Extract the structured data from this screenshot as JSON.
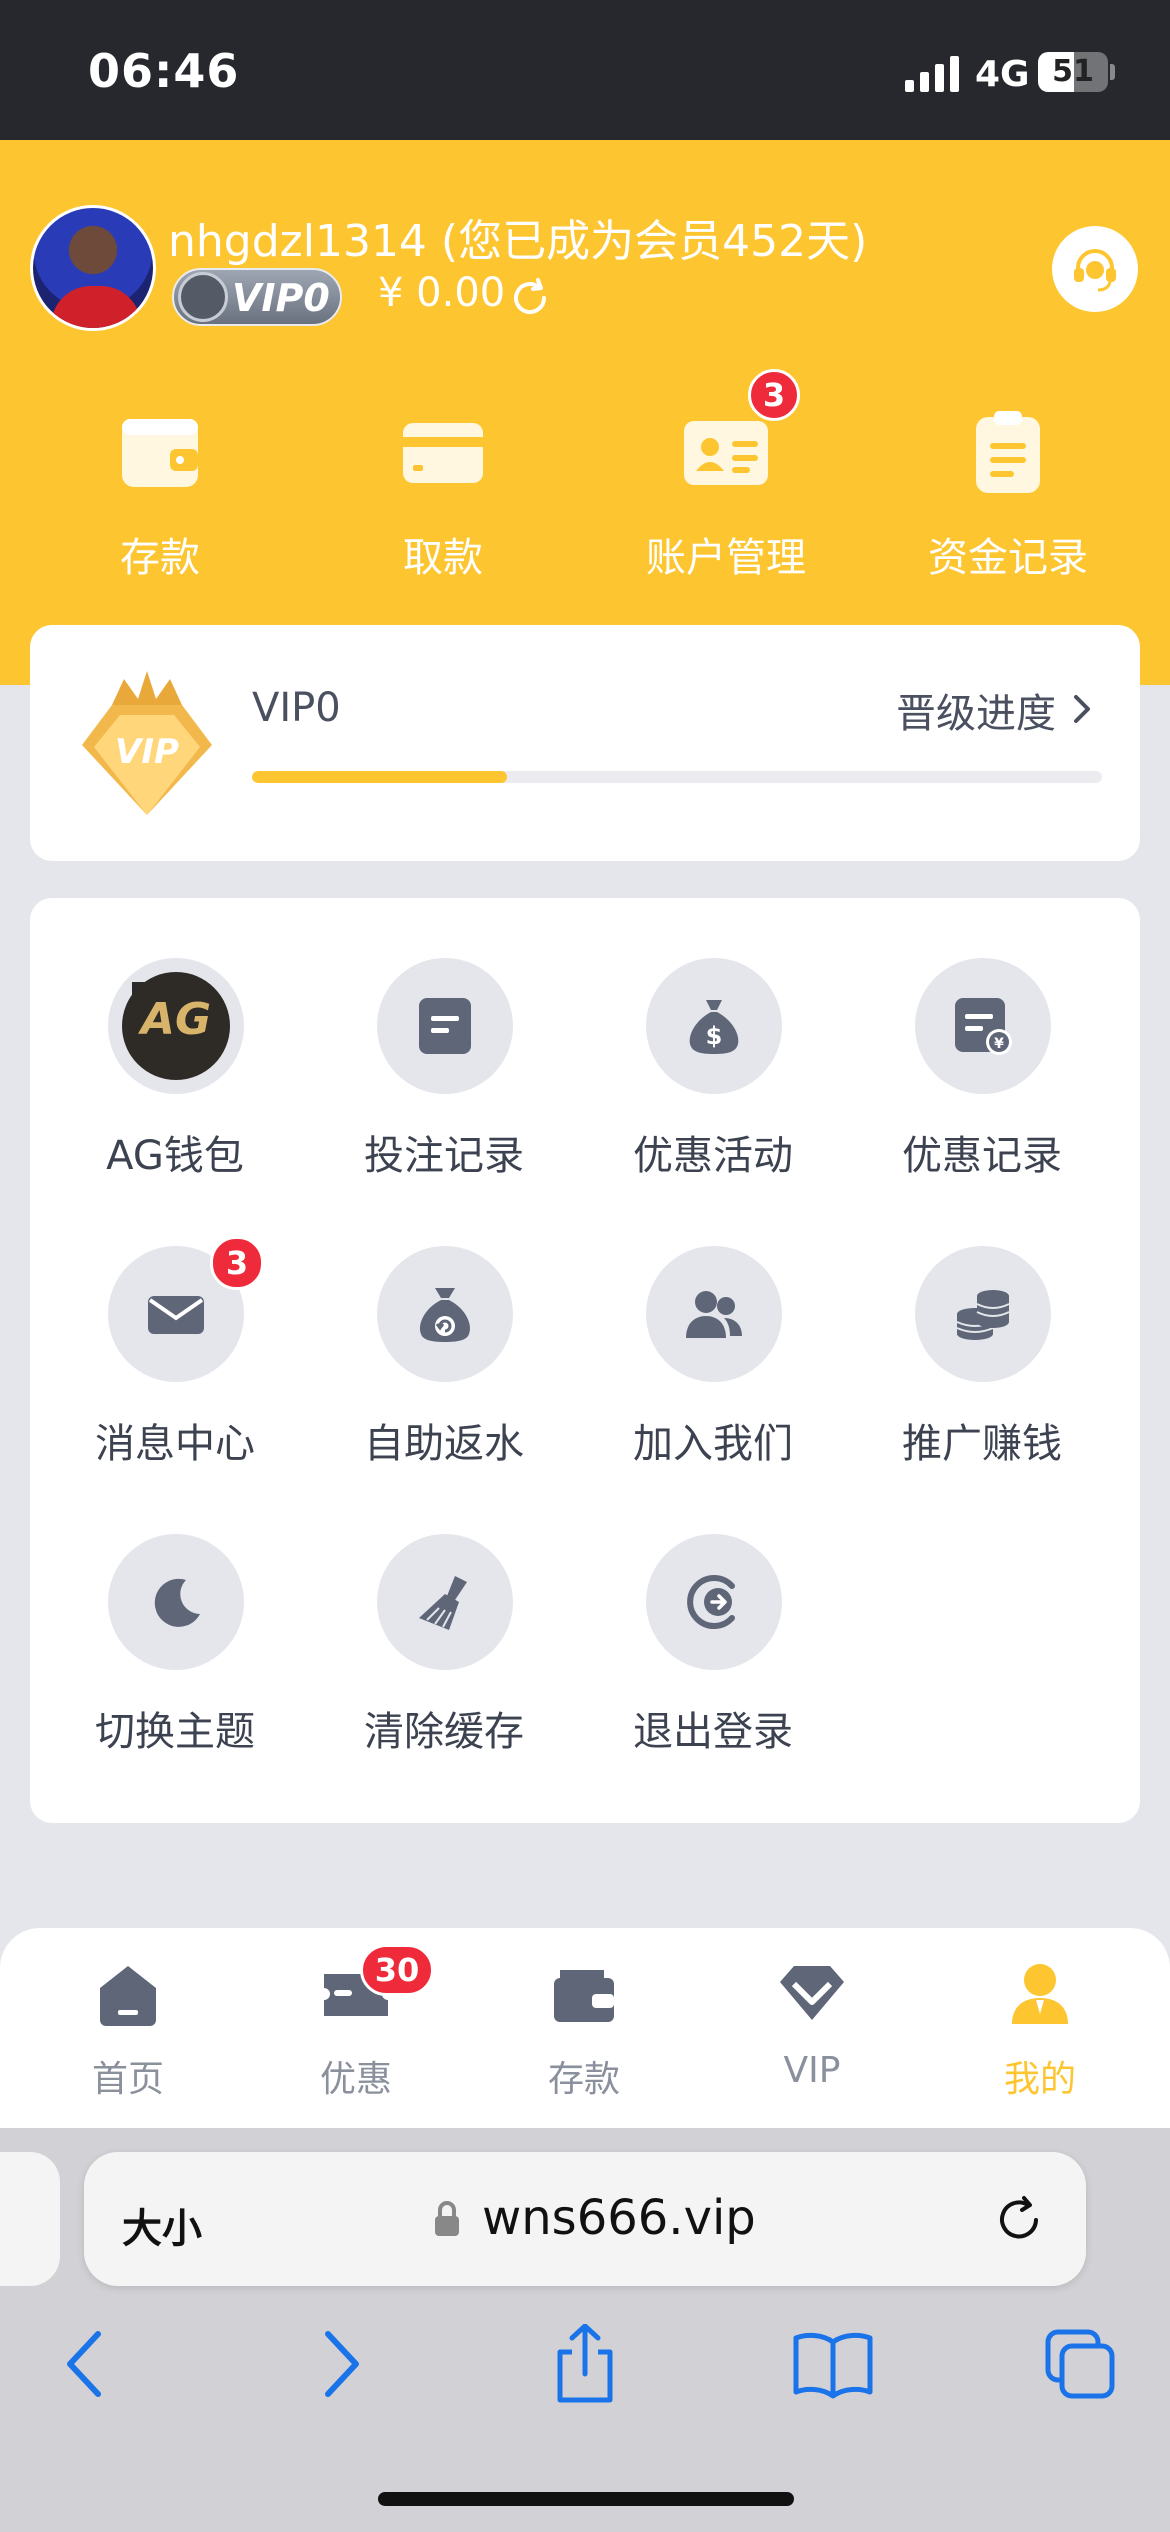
{
  "status_bar": {
    "time": "06:46",
    "network": "4G",
    "battery": "51",
    "battery_level": 0.51
  },
  "header": {
    "username": "nhgdzl1314 (您已成为会员452天)",
    "vip_badge": "VIP0",
    "balance": "¥ 0.00",
    "quick_actions": [
      {
        "label": "存款",
        "icon": "wallet-icon"
      },
      {
        "label": "取款",
        "icon": "card-icon"
      },
      {
        "label": "账户管理",
        "icon": "id-card-icon",
        "badge": "3"
      },
      {
        "label": "资金记录",
        "icon": "clipboard-icon"
      }
    ]
  },
  "vip_card": {
    "level": "VIP0",
    "progress_link": "晋级进度",
    "emblem_text": "VIP",
    "progress": 0.3
  },
  "menu": {
    "items": [
      {
        "label": "AG钱包",
        "icon": "ag-wallet-icon",
        "logo_text": "AG"
      },
      {
        "label": "投注记录",
        "icon": "bet-record-icon"
      },
      {
        "label": "优惠活动",
        "icon": "money-bag-icon"
      },
      {
        "label": "优惠记录",
        "icon": "promo-record-icon"
      },
      {
        "label": "消息中心",
        "icon": "envelope-icon",
        "badge": "3"
      },
      {
        "label": "自助返水",
        "icon": "rebate-bag-icon"
      },
      {
        "label": "加入我们",
        "icon": "users-icon"
      },
      {
        "label": "推广赚钱",
        "icon": "coins-icon"
      },
      {
        "label": "切换主题",
        "icon": "moon-icon"
      },
      {
        "label": "清除缓存",
        "icon": "broom-icon"
      },
      {
        "label": "退出登录",
        "icon": "logout-icon"
      }
    ]
  },
  "tabbar": {
    "tabs": [
      {
        "label": "首页",
        "icon": "home-icon"
      },
      {
        "label": "优惠",
        "icon": "ticket-icon",
        "badge": "30"
      },
      {
        "label": "存款",
        "icon": "wallet-icon"
      },
      {
        "label": "VIP",
        "icon": "diamond-icon"
      },
      {
        "label": "我的",
        "icon": "person-icon",
        "active": true
      }
    ]
  },
  "browser": {
    "text_size": "大小",
    "url": "wns666.vip"
  },
  "colors": {
    "accent": "#fdc530",
    "badge": "#ef2b3b",
    "icon_gray": "#5e6678",
    "background": "#e4e6ec"
  }
}
